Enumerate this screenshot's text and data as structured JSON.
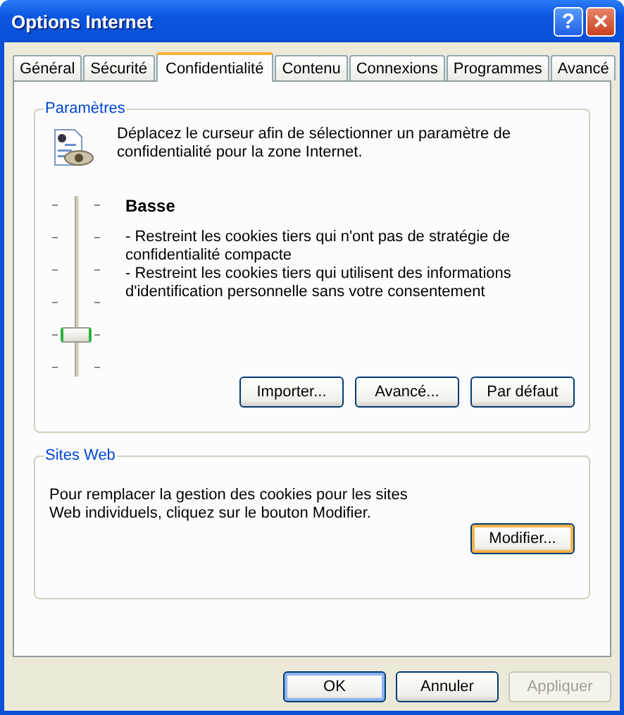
{
  "window": {
    "title": "Options Internet",
    "controls": [
      {
        "kind": "help",
        "label": "?"
      },
      {
        "kind": "close",
        "label": "×"
      }
    ]
  },
  "tabs": [
    {
      "label": "Général",
      "selected": false
    },
    {
      "label": "Sécurité",
      "selected": false
    },
    {
      "label": "Confidentialité",
      "selected": true
    },
    {
      "label": "Contenu",
      "selected": false
    },
    {
      "label": "Connexions",
      "selected": false
    },
    {
      "label": "Programmes",
      "selected": false
    },
    {
      "label": "Avancé",
      "selected": false
    }
  ],
  "settings": {
    "title": "Paramètres",
    "intro": "Déplacez le curseur afin de sélectionner un paramètre de confidentialité pour la zone Internet.",
    "slider": {
      "level": 0.2
    },
    "level_name": "Basse",
    "description": [
      "- Restreint les cookies tiers qui n'ont pas de stratégie de confidentialité compacte",
      "- Restreint les cookies tiers qui utilisent des informations d'identification personnelle sans votre consentement"
    ],
    "buttons": [
      {
        "label": "Importer...",
        "focused": false
      },
      {
        "label": "Avancé...",
        "focused": false
      },
      {
        "label": "Par défaut",
        "focused": false
      }
    ]
  },
  "websites": {
    "title": "Sites Web",
    "text": "Pour remplacer la gestion des cookies pour les sites Web individuels, cliquez sur le bouton Modifier.",
    "buttons": [
      {
        "label": "Modifier...",
        "focused": true
      }
    ]
  },
  "buttons": [
    {
      "label": "OK",
      "default": true,
      "disabled": false
    },
    {
      "label": "Annuler",
      "default": false,
      "disabled": false
    },
    {
      "label": "Appliquer",
      "default": false,
      "disabled": true
    }
  ]
}
